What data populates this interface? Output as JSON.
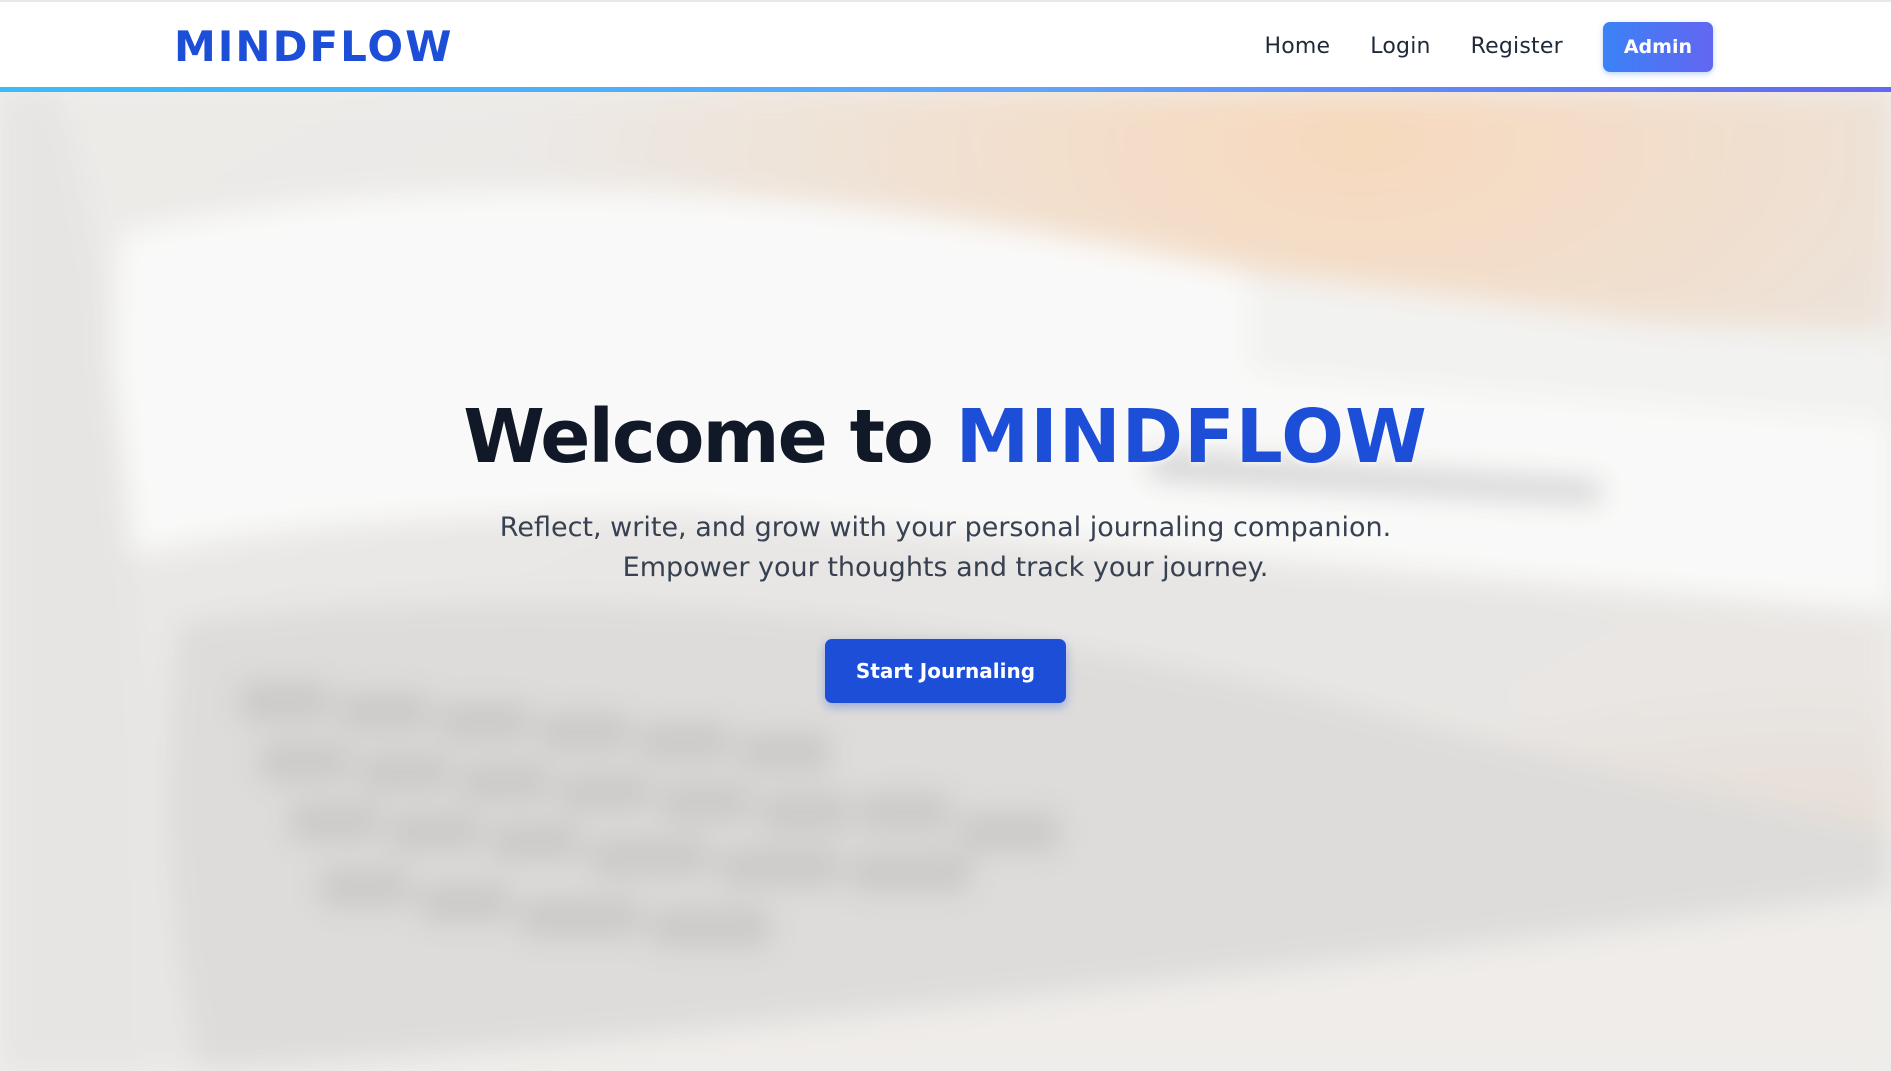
{
  "navbar": {
    "brand": "MINDFLOW",
    "links": [
      {
        "label": "Home"
      },
      {
        "label": "Login"
      },
      {
        "label": "Register"
      }
    ],
    "admin_label": "Admin"
  },
  "hero": {
    "title_prefix": "Welcome to",
    "title_accent": "MINDFLOW",
    "subtitle_line1": "Reflect, write, and grow with your personal journaling companion.",
    "subtitle_line2": "Empower your thoughts and track your journey.",
    "cta_label": "Start Journaling",
    "background_image": "blurred-laptop-notebook-photo"
  },
  "colors": {
    "brand": "#1d4ed8",
    "admin_gradient_start": "#3b82f6",
    "admin_gradient_end": "#6366f1",
    "navbar_accent_start": "#38bdf8",
    "navbar_accent_end": "#6366f1",
    "heading": "#111827",
    "body_text": "#374151"
  }
}
